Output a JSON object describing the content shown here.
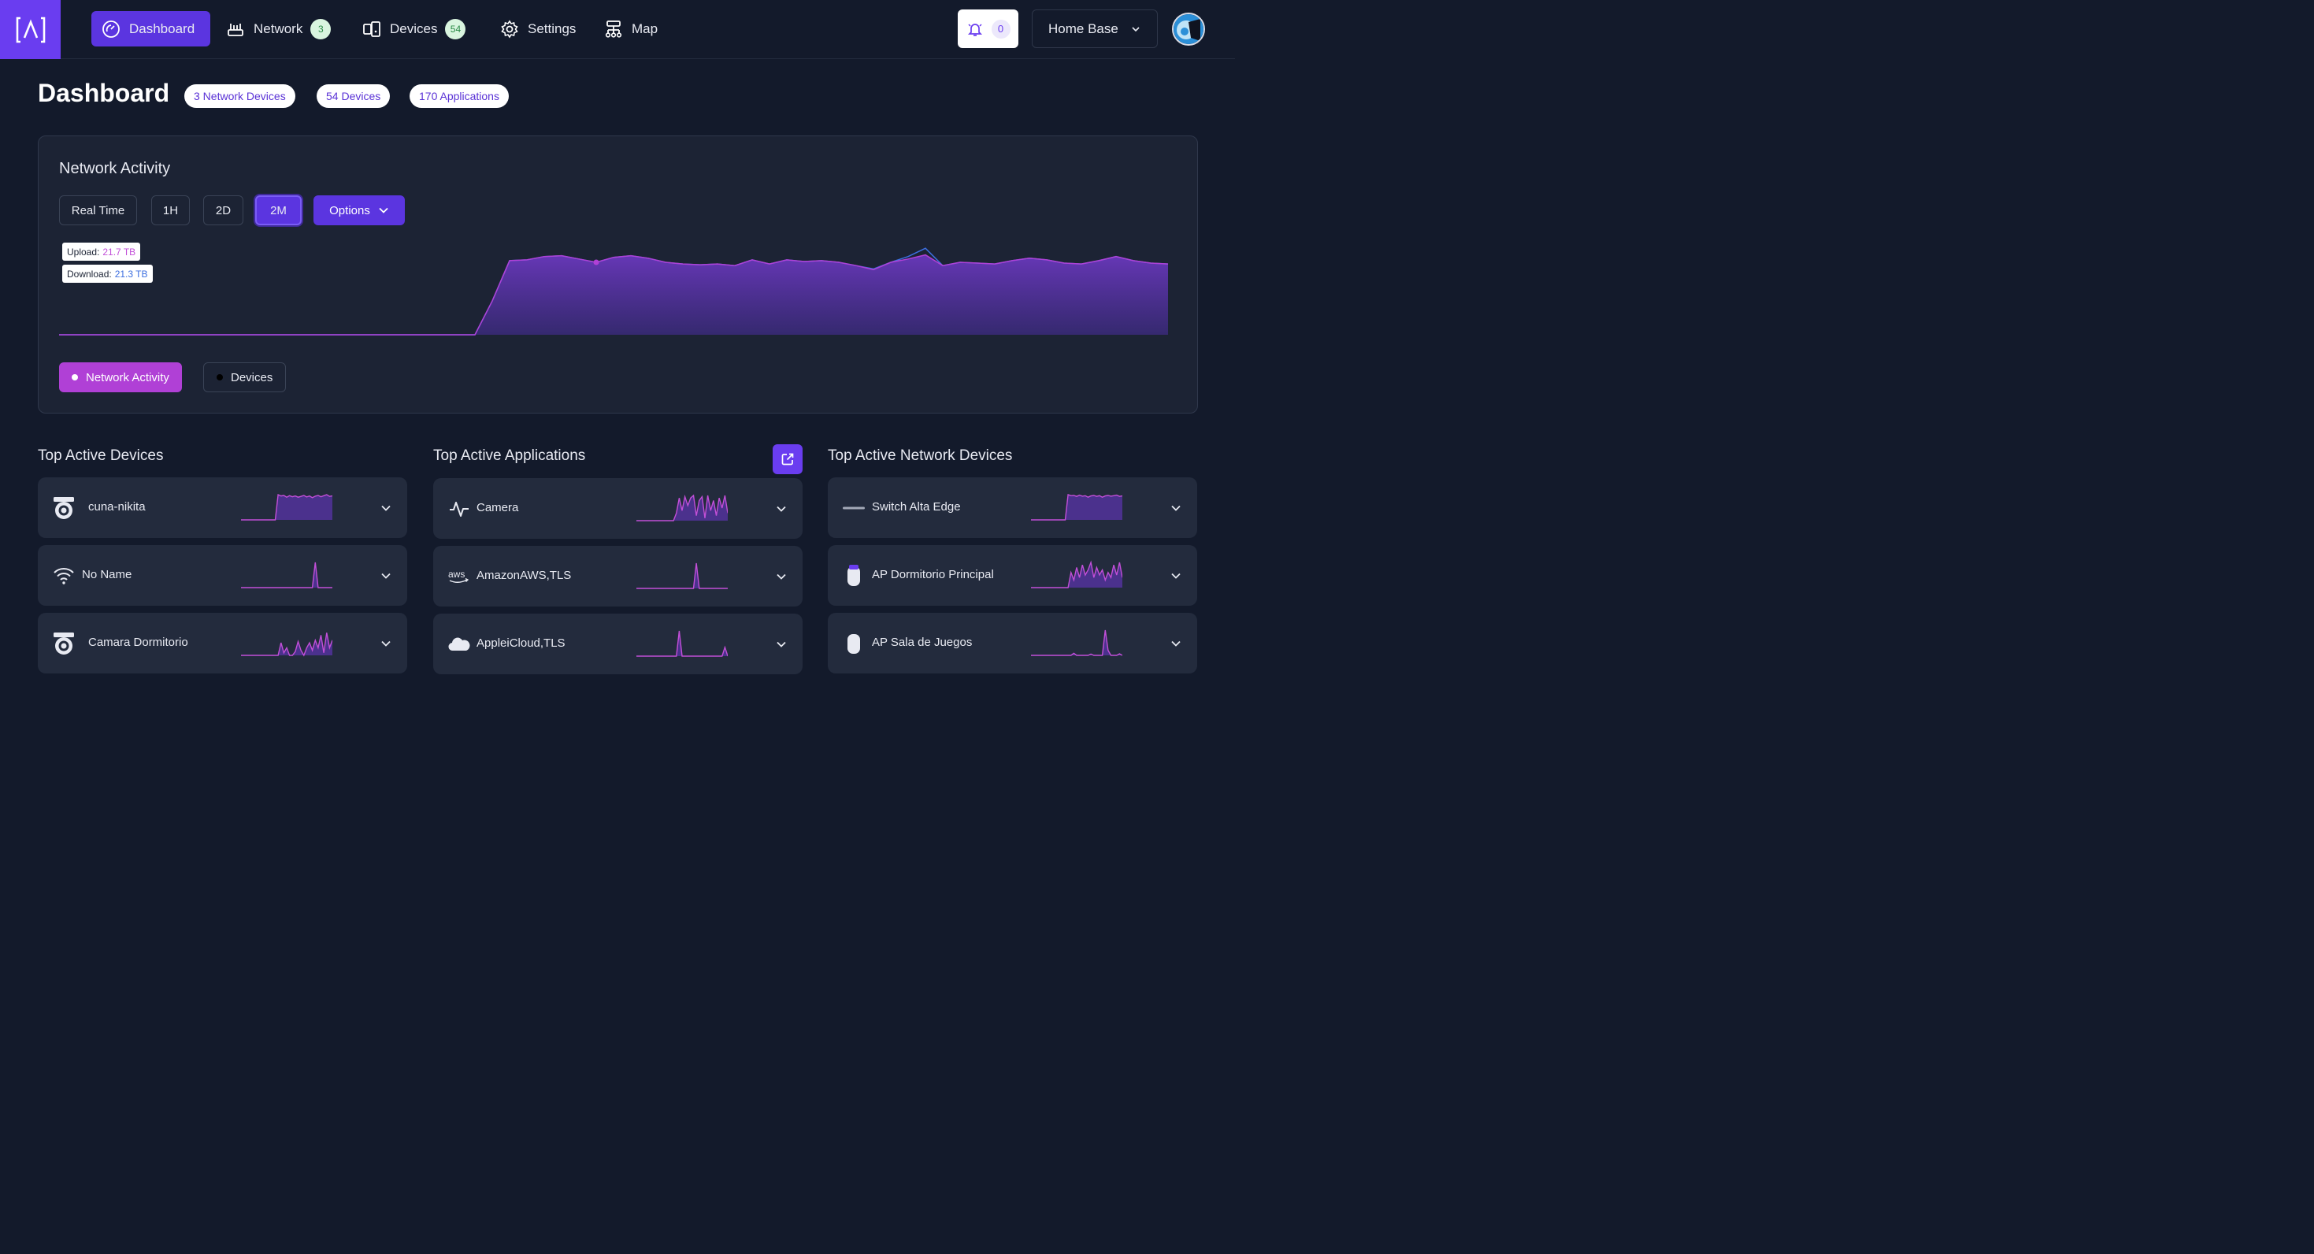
{
  "nav": {
    "items": [
      {
        "label": "Dashboard",
        "icon": "speedometer-icon",
        "active": true
      },
      {
        "label": "Network",
        "icon": "router-icon",
        "badge": "3"
      },
      {
        "label": "Devices",
        "icon": "devices-icon",
        "badge": "54"
      },
      {
        "label": "Settings",
        "icon": "gear-icon"
      },
      {
        "label": "Map",
        "icon": "topology-icon"
      }
    ],
    "notifications_count": "0",
    "site": "Home Base"
  },
  "page": {
    "title": "Dashboard",
    "pills": [
      "3 Network Devices",
      "54 Devices",
      "170 Applications"
    ]
  },
  "activity": {
    "title": "Network Activity",
    "ranges": [
      "Real Time",
      "1H",
      "2D",
      "2M"
    ],
    "active_range": "2M",
    "options_label": "Options",
    "tooltip": {
      "upload_label": "Upload:",
      "upload_value": "21.7 TB",
      "download_label": "Download:",
      "download_value": "21.3 TB"
    },
    "legend": [
      "Network Activity",
      "Devices"
    ],
    "colors": {
      "upload": "#b040d6",
      "download": "#3d6fe0",
      "fill": "#5a34a8",
      "accent": "#5b35e0"
    }
  },
  "chart_data": {
    "type": "area",
    "series": [
      {
        "values": [
          0,
          0,
          0,
          0,
          0,
          0,
          0,
          0,
          0,
          0,
          0,
          0,
          0,
          0,
          0,
          0,
          0,
          0,
          0,
          0,
          0,
          0,
          0,
          0,
          0,
          0.41,
          0.9,
          0.91,
          0.95,
          0.96,
          0.92,
          0.88,
          0.94,
          0.96,
          0.93,
          0.88,
          0.86,
          0.85,
          0.86,
          0.84,
          0.91,
          0.86,
          0.91,
          0.89,
          0.9,
          0.88,
          0.84,
          0.79,
          0.88,
          0.92,
          0.97,
          0.84,
          0.88,
          0.87,
          0.86,
          0.9,
          0.93,
          0.91,
          0.87,
          0.86,
          0.9,
          0.95,
          0.9,
          0.87,
          0.86
        ]
      },
      {
        "values": [
          0,
          0,
          0,
          0,
          0,
          0,
          0,
          0,
          0,
          0,
          0,
          0,
          0,
          0,
          0,
          0,
          0,
          0,
          0,
          0,
          0,
          0,
          0,
          0,
          0,
          0.41,
          0.9,
          0.91,
          0.95,
          0.96,
          0.92,
          0.88,
          0.94,
          0.96,
          0.93,
          0.88,
          0.86,
          0.85,
          0.86,
          0.84,
          0.91,
          0.86,
          0.91,
          0.89,
          0.9,
          0.88,
          0.84,
          0.8,
          0.88,
          0.95,
          1.05,
          0.84,
          0.88,
          0.87,
          0.86,
          0.9,
          0.93,
          0.91,
          0.87,
          0.86,
          0.9,
          0.95,
          0.9,
          0.87,
          0.86
        ]
      }
    ]
  },
  "top_devices": {
    "title": "Top Active Devices",
    "items": [
      {
        "name": "cuna-nikita",
        "icon": "camera-icon",
        "spark": [
          0,
          0,
          0,
          0,
          0,
          0,
          0,
          0,
          0,
          0,
          0,
          0,
          0,
          1,
          0.95,
          0.97,
          0.9,
          0.96,
          0.92,
          0.95,
          0.9,
          0.93,
          0.97,
          0.91,
          0.95,
          0.88,
          0.94,
          0.97,
          0.92,
          0.96,
          1,
          0.93,
          0.95
        ]
      },
      {
        "name": "No Name",
        "icon": "wifi-icon",
        "spark": [
          0,
          0,
          0,
          0,
          0,
          0,
          0,
          0,
          0,
          0,
          0,
          0,
          0,
          0,
          0,
          0,
          0,
          0,
          0,
          0,
          0,
          0,
          0,
          0,
          0,
          0,
          1,
          0,
          0,
          0,
          0,
          0,
          0
        ]
      },
      {
        "name": "Camara Dormitorio",
        "icon": "camera-icon",
        "spark": [
          0,
          0,
          0,
          0,
          0,
          0,
          0,
          0,
          0,
          0,
          0,
          0,
          0,
          0,
          0.5,
          0.1,
          0.3,
          0,
          0,
          0.15,
          0.55,
          0.2,
          0,
          0.3,
          0.5,
          0.2,
          0.6,
          0.3,
          0.8,
          0.1,
          0.9,
          0.3,
          0.6
        ]
      }
    ]
  },
  "top_apps": {
    "title": "Top Active Applications",
    "items": [
      {
        "name": "Camera",
        "icon": "activity-icon",
        "spark": [
          0,
          0,
          0,
          0,
          0,
          0,
          0,
          0,
          0,
          0,
          0,
          0,
          0,
          0,
          0.3,
          0.9,
          0.4,
          0.95,
          0.6,
          0.9,
          1,
          0.2,
          0.8,
          0.95,
          0.1,
          1,
          0.4,
          0.8,
          0.2,
          0.9,
          0.5,
          1,
          0.3
        ]
      },
      {
        "name": "AmazonAWS,TLS",
        "icon": "aws-icon",
        "spark": [
          0,
          0,
          0,
          0,
          0,
          0,
          0,
          0,
          0,
          0,
          0,
          0,
          0,
          0,
          0,
          0,
          0,
          0,
          0,
          0,
          0,
          1,
          0,
          0,
          0,
          0,
          0,
          0,
          0,
          0,
          0,
          0,
          0
        ]
      },
      {
        "name": "AppleiCloud,TLS",
        "icon": "cloud-icon",
        "spark": [
          0,
          0,
          0,
          0,
          0,
          0,
          0,
          0,
          0,
          0,
          0,
          0,
          0,
          0,
          0,
          1,
          0,
          0,
          0,
          0,
          0,
          0,
          0,
          0,
          0,
          0,
          0,
          0,
          0,
          0,
          0,
          0.35,
          0
        ]
      }
    ]
  },
  "top_network": {
    "title": "Top Active Network Devices",
    "items": [
      {
        "name": "Switch Alta Edge",
        "icon": "switch-icon",
        "spark": [
          0,
          0,
          0,
          0,
          0,
          0,
          0,
          0,
          0,
          0,
          0,
          0,
          0,
          1,
          0.96,
          0.97,
          0.93,
          0.98,
          0.94,
          0.96,
          0.9,
          0.95,
          0.97,
          0.93,
          0.96,
          0.9,
          0.95,
          0.97,
          0.94,
          0.96,
          0.98,
          0.93,
          0.95
        ]
      },
      {
        "name": "AP Dormitorio Principal",
        "icon": "access-point-icon",
        "spark": [
          0,
          0,
          0,
          0,
          0,
          0,
          0,
          0,
          0,
          0,
          0,
          0,
          0,
          0,
          0.6,
          0.3,
          0.8,
          0.4,
          0.9,
          0.5,
          0.7,
          1,
          0.4,
          0.8,
          0.5,
          0.7,
          0.3,
          0.6,
          0.4,
          0.9,
          0.5,
          1,
          0.4
        ]
      },
      {
        "name": "AP Sala de Juegos",
        "icon": "access-point-icon",
        "spark": [
          0,
          0,
          0,
          0,
          0,
          0,
          0,
          0,
          0,
          0,
          0,
          0,
          0,
          0,
          0,
          0.08,
          0,
          0,
          0,
          0,
          0,
          0.05,
          0,
          0,
          0,
          0,
          1,
          0.2,
          0,
          0,
          0,
          0.06,
          0
        ]
      }
    ]
  }
}
